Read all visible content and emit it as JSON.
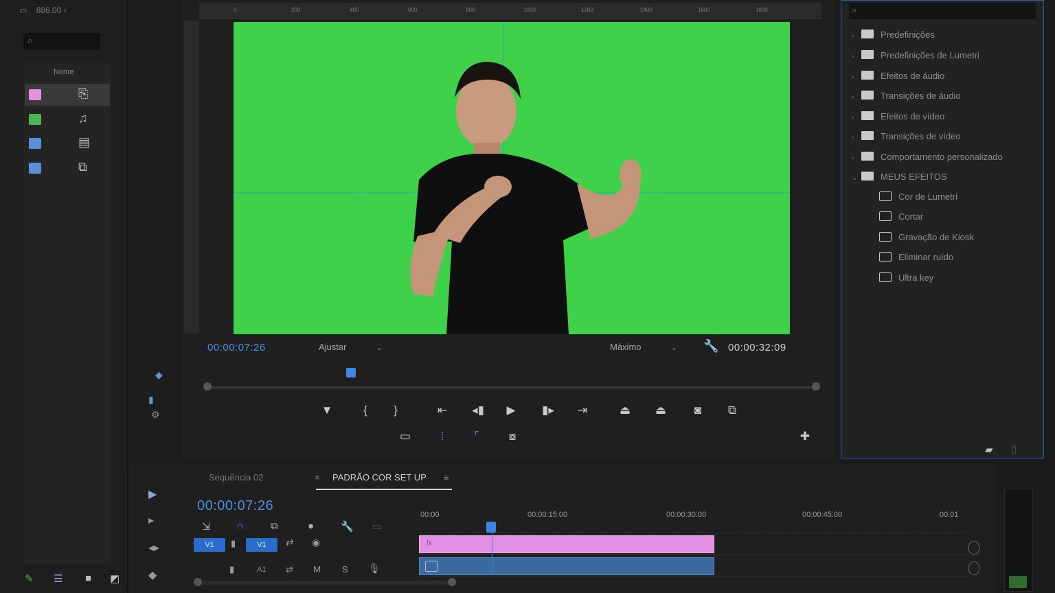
{
  "project_panel": {
    "title": "886.00",
    "column_name": "Nome",
    "bins": [
      {
        "color": "#e58fe3"
      },
      {
        "color": "#4db454"
      },
      {
        "color": "#5a8fd8"
      },
      {
        "color": "#5a8fd8"
      }
    ]
  },
  "program_monitor": {
    "current_timecode": "00:00:07:26",
    "fit_label": "Ajustar",
    "quality_label": "Máximo",
    "duration_timecode": "00:00:32:09",
    "ruler_ticks": [
      "0",
      "200",
      "400",
      "600",
      "800",
      "1000",
      "1200",
      "1400",
      "1600",
      "1800"
    ],
    "background_color": "#3fd14a",
    "guide_color": "#1cb4af"
  },
  "effects_panel": {
    "items": [
      {
        "label": "Predefinições",
        "level": 0,
        "expanded": false
      },
      {
        "label": "Predefinições de Lumetri",
        "level": 0,
        "expanded": false
      },
      {
        "label": "Efeitos de áudio",
        "level": 0,
        "expanded": false
      },
      {
        "label": "Transições de áudio",
        "level": 0,
        "expanded": false
      },
      {
        "label": "Efeitos de vídeo",
        "level": 0,
        "expanded": false
      },
      {
        "label": "Transições de vídeo",
        "level": 0,
        "expanded": false
      },
      {
        "label": "Comportamento personalizado",
        "level": 0,
        "expanded": false
      },
      {
        "label": "MEUS EFEITOS",
        "level": 0,
        "expanded": true
      },
      {
        "label": "Cor de Lumetri",
        "level": 1
      },
      {
        "label": "Cortar",
        "level": 1
      },
      {
        "label": "Gravação de Kiosk",
        "level": 1
      },
      {
        "label": "Eliminar ruído",
        "level": 1
      },
      {
        "label": "Ultra key",
        "level": 1
      }
    ]
  },
  "timeline": {
    "tabs": [
      {
        "label": "Sequência 02",
        "active": false
      },
      {
        "label": "PADRÃO COR SET UP",
        "active": true
      }
    ],
    "current_timecode": "00:00:07:26",
    "ruler_labels": [
      "00:00",
      "00:00:15:00",
      "00:00:30:00",
      "00:00:45:00",
      "00:01"
    ],
    "tracks": [
      {
        "button": "V1",
        "target": "V1"
      },
      {
        "button": "A1",
        "target": "A1"
      }
    ],
    "video_clip_color": "#e38ee0",
    "audio_clip_color": "#3a6a9e",
    "accent_color": "#3b86e0"
  }
}
